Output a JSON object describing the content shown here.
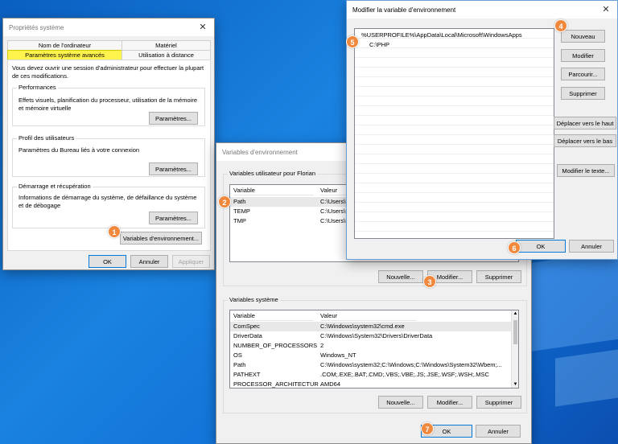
{
  "sysprops": {
    "title": "Propriétés système",
    "tabs_row1": [
      "Nom de l'ordinateur",
      "Matériel"
    ],
    "tabs_row2": [
      "Paramètres système avancés",
      "Utilisation à distance"
    ],
    "admin_note": "Vous devez ouvrir une session d'administrateur pour effectuer la plupart de ces modifications.",
    "perf_title": "Performances",
    "perf_desc": "Effets visuels, planification du processeur, utilisation de la mémoire et mémoire virtuelle",
    "profile_title": "Profil des utilisateurs",
    "profile_desc": "Paramètres du Bureau liés à votre connexion",
    "startup_title": "Démarrage et récupération",
    "startup_desc": "Informations de démarrage du système, de défaillance du système et de débogage",
    "params_label": "Paramètres...",
    "envvars_label": "Variables d'environnement...",
    "ok": "OK",
    "cancel": "Annuler",
    "apply": "Appliquer"
  },
  "envvars": {
    "title": "Variables d'environnement",
    "user_group": "Variables utilisateur pour Florian",
    "col_variable": "Variable",
    "col_value": "Valeur",
    "user_rows": [
      {
        "name": "Path",
        "value": "C:\\Users\\F"
      },
      {
        "name": "TEMP",
        "value": "C:\\Users\\F"
      },
      {
        "name": "TMP",
        "value": "C:\\Users\\F"
      }
    ],
    "new": "Nouvelle...",
    "edit": "Modifier...",
    "delete": "Supprimer",
    "system_group": "Variables système",
    "system_rows": [
      {
        "name": "ComSpec",
        "value": "C:\\Windows\\system32\\cmd.exe"
      },
      {
        "name": "DriverData",
        "value": "C:\\Windows\\System32\\Drivers\\DriverData"
      },
      {
        "name": "NUMBER_OF_PROCESSORS",
        "value": "2"
      },
      {
        "name": "OS",
        "value": "Windows_NT"
      },
      {
        "name": "Path",
        "value": "C:\\Windows\\system32;C:\\Windows;C:\\Windows\\System32\\Wbem;..."
      },
      {
        "name": "PATHEXT",
        "value": ".COM;.EXE;.BAT;.CMD;.VBS;.VBE;.JS;.JSE;.WSF;.WSH;.MSC"
      },
      {
        "name": "PROCESSOR_ARCHITECTURE",
        "value": "AMD64"
      }
    ],
    "ok": "OK",
    "cancel": "Annuler"
  },
  "editvar": {
    "title": "Modifier la variable d'environnement",
    "entries": [
      "%USERPROFILE%\\AppData\\Local\\Microsoft\\WindowsApps",
      "C:\\PHP"
    ],
    "new": "Nouveau",
    "edit": "Modifier",
    "browse": "Parcourir...",
    "delete": "Supprimer",
    "move_up": "Déplacer vers le haut",
    "move_down": "Déplacer vers le bas",
    "edit_text": "Modifier le texte...",
    "ok": "OK",
    "cancel": "Annuler"
  },
  "badges": [
    "1",
    "2",
    "3",
    "4",
    "5",
    "6",
    "7"
  ],
  "colors": {
    "badge": "#f0883e",
    "highlight_tab": "#fff34d",
    "selected_row": "#e8e8e8",
    "accent": "#0078d7"
  }
}
